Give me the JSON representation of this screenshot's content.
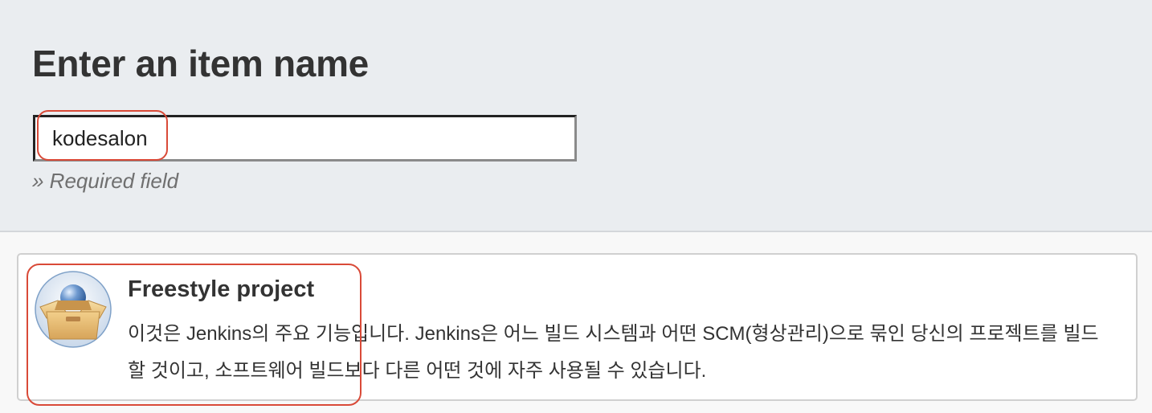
{
  "header": {
    "title": "Enter an item name",
    "name_input": {
      "value": "kodesalon",
      "placeholder": ""
    },
    "required_hint": "» Required field"
  },
  "items": [
    {
      "icon": "freestyle-project-icon",
      "title": "Freestyle project",
      "description": "이것은 Jenkins의 주요 기능입니다. Jenkins은 어느 빌드 시스템과 어떤 SCM(형상관리)으로 묶인 당신의 프로젝트를 빌드할 것이고, 소프트웨어 빌드보다 다른 어떤 것에 자주 사용될 수 있습니다."
    }
  ],
  "colors": {
    "header_bg": "#eaedf0",
    "highlight": "#d94a38",
    "text": "#333333"
  }
}
